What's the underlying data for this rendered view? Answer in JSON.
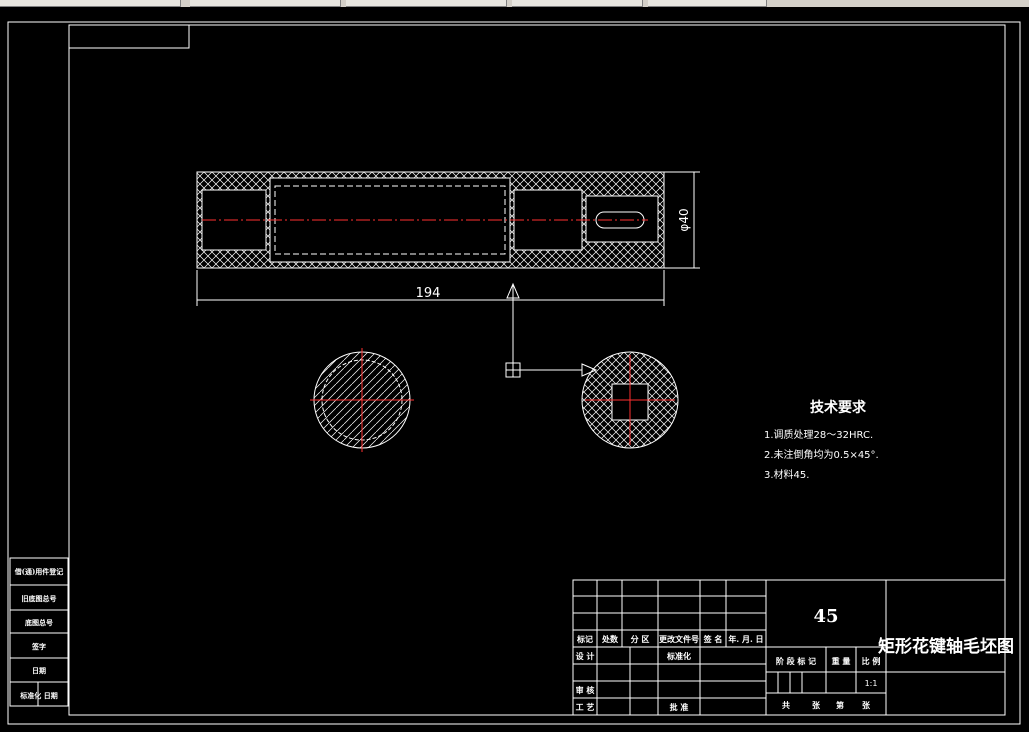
{
  "drawing": {
    "dimension_length": "194",
    "dimension_diameter": "φ40",
    "tech_req_title": "技术要求",
    "tech_req_items": [
      "1.调质处理28～32HRC.",
      "2.未注倒角均为0.5×45°.",
      "3.材料45."
    ]
  },
  "side_table": {
    "rows": [
      "借(通)用件登记",
      "旧底图总号",
      "底图总号",
      "签字",
      "日期",
      "标准化 日期"
    ]
  },
  "title_block": {
    "material": "45",
    "title": "矩形花键轴毛坯图",
    "scale": "1:1",
    "row_labels": [
      "标记",
      "处数",
      "分 区",
      "更改文件号",
      "签 名",
      "年. 月. 日"
    ],
    "design": "设 计",
    "standardize": "标准化",
    "review": "审 核",
    "process": "工 艺",
    "approve": "批 准",
    "stage_mark": "阶 段 标 记",
    "weight": "重 量",
    "ratio": "比 例",
    "sheets_total": "共",
    "sheets_label": "张",
    "sheet_no": "第",
    "sheet_label": "张"
  },
  "colors": {
    "background": "#000000",
    "line": "#ffffff",
    "centerline": "#ff0000"
  }
}
